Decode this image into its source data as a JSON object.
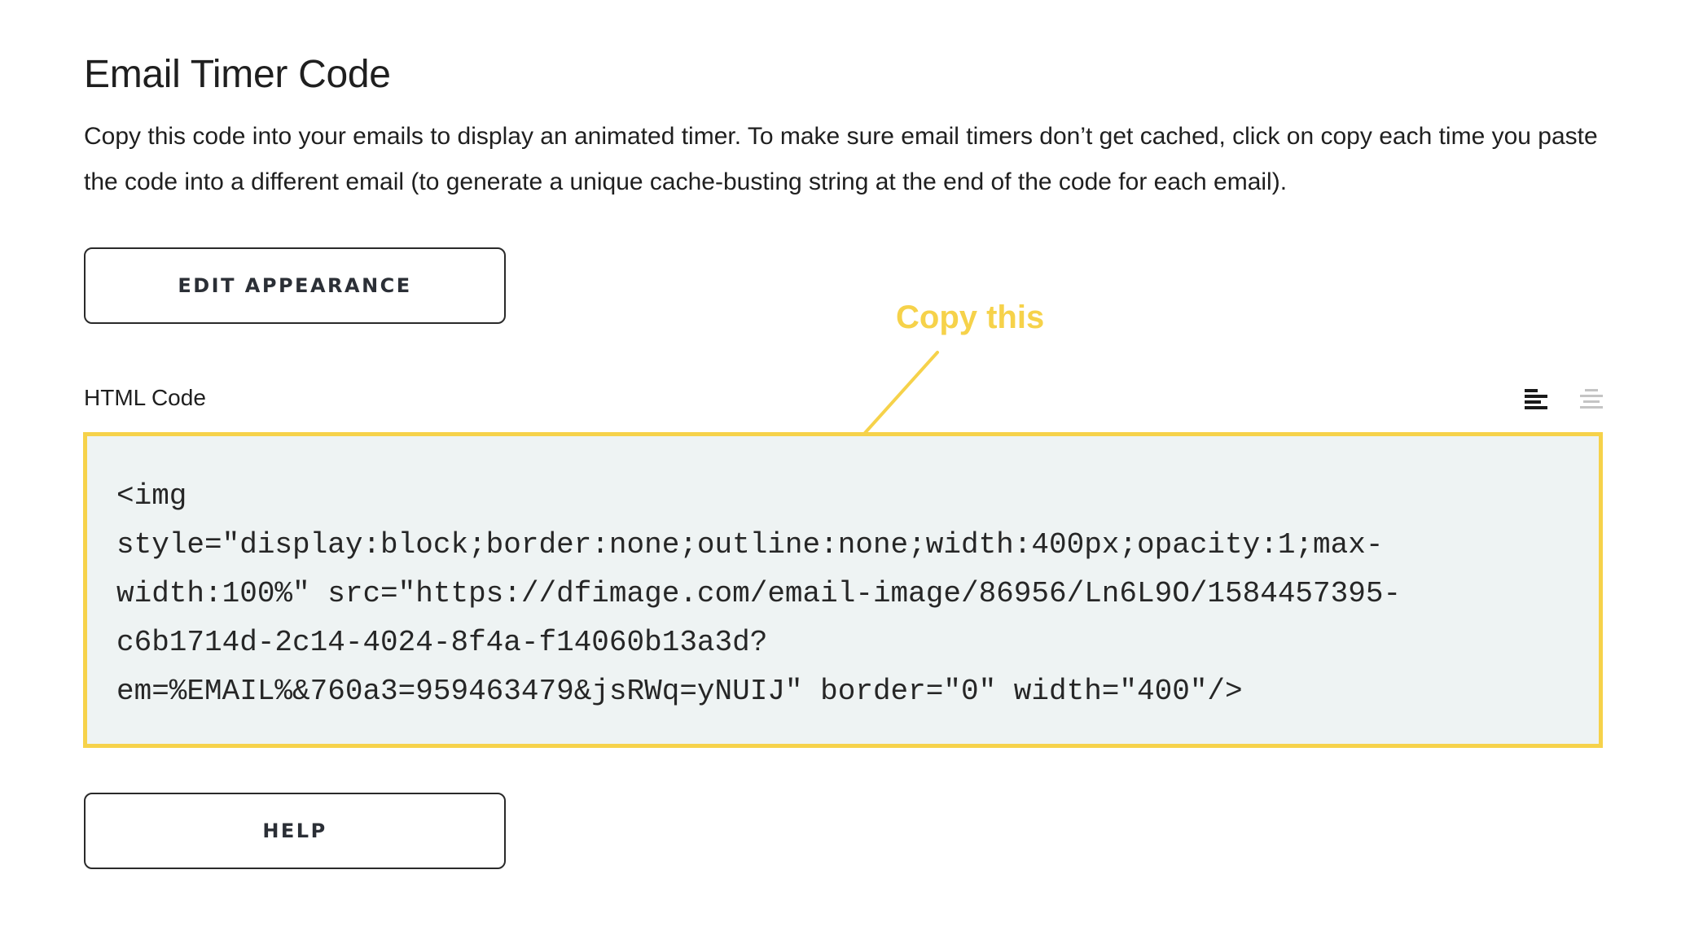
{
  "header": {
    "title": "Email Timer Code",
    "description": "Copy this code into your emails to display an animated timer. To make sure email timers don’t get cached, click on copy each time you paste the code into a different email (to generate a unique cache-busting string at the end of the code for each email)."
  },
  "buttons": {
    "edit_appearance": "EDIT APPEARANCE",
    "help": "HELP"
  },
  "annotation": {
    "label": "Copy this",
    "color": "#f6d24a"
  },
  "code_section": {
    "label": "HTML Code",
    "icons": [
      "align-left-icon",
      "align-center-icon"
    ],
    "code": "<img\nstyle=\"display:block;border:none;outline:none;width:400px;opacity:1;max-\nwidth:100%\" src=\"https://dfimage.com/email-image/86956/Ln6L9O/1584457395-\nc6b1714d-2c14-4024-8f4a-f14060b13a3d?\nem=%EMAIL%&760a3=959463479&jsRWq=yNUIJ\" border=\"0\" width=\"400\"/>"
  },
  "colors": {
    "highlight": "#f6d24a",
    "code_background": "#eef3f3",
    "text": "#1f1f1f"
  }
}
